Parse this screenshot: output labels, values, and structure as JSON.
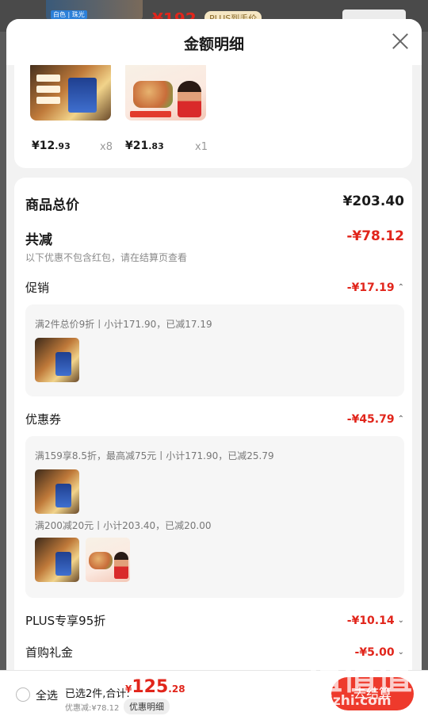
{
  "background": {
    "thumb_tag": "白色 | 珠光",
    "price": "¥192",
    "plus_tag": "PLUS到手价"
  },
  "sheet": {
    "title": "金额明细"
  },
  "products": [
    {
      "price_int": "¥12",
      "price_dec": ".93",
      "qty": "x8"
    },
    {
      "price_int": "¥21",
      "price_dec": ".83",
      "qty": "x1"
    }
  ],
  "summary": {
    "total_label": "商品总价",
    "total_value": "¥203.40",
    "reduce_label": "共减",
    "reduce_value": "-¥78.12",
    "reduce_note": "以下优惠不包含红包，请在结算页查看"
  },
  "promotion": {
    "label": "促销",
    "value": "-¥17.19",
    "lines": [
      "满2件总价9折丨小计171.90，已减17.19"
    ]
  },
  "coupon": {
    "label": "优惠券",
    "value": "-¥45.79",
    "lines": [
      "满159享8.5折，最高减75元丨小计171.90，已减25.79",
      "满200减20元丨小计203.40，已减20.00"
    ]
  },
  "plus": {
    "label": "PLUS专享95折",
    "value": "-¥10.14"
  },
  "first_buy": {
    "label": "首购礼金",
    "value": "-¥5.00"
  },
  "bottom": {
    "select_all": "全选",
    "selected_total": "已选2件,合计:",
    "price_cur": "¥",
    "price_int": "125",
    "price_dec": ".28",
    "discount_note": "优惠减:¥78.12",
    "detail_button": "优惠明细",
    "checkout_button": "去结算"
  },
  "icons": {
    "close": "close-icon",
    "chevron_up": "chevron-up-icon",
    "chevron_down": "chevron-down-icon",
    "radio": "radio-unchecked-icon"
  },
  "colors": {
    "accent_red": "#e1251b",
    "checkout_red": "#ee3a2c"
  },
  "watermark": {
    "glyphs": "值值值",
    "url": "zhizhi.com"
  }
}
